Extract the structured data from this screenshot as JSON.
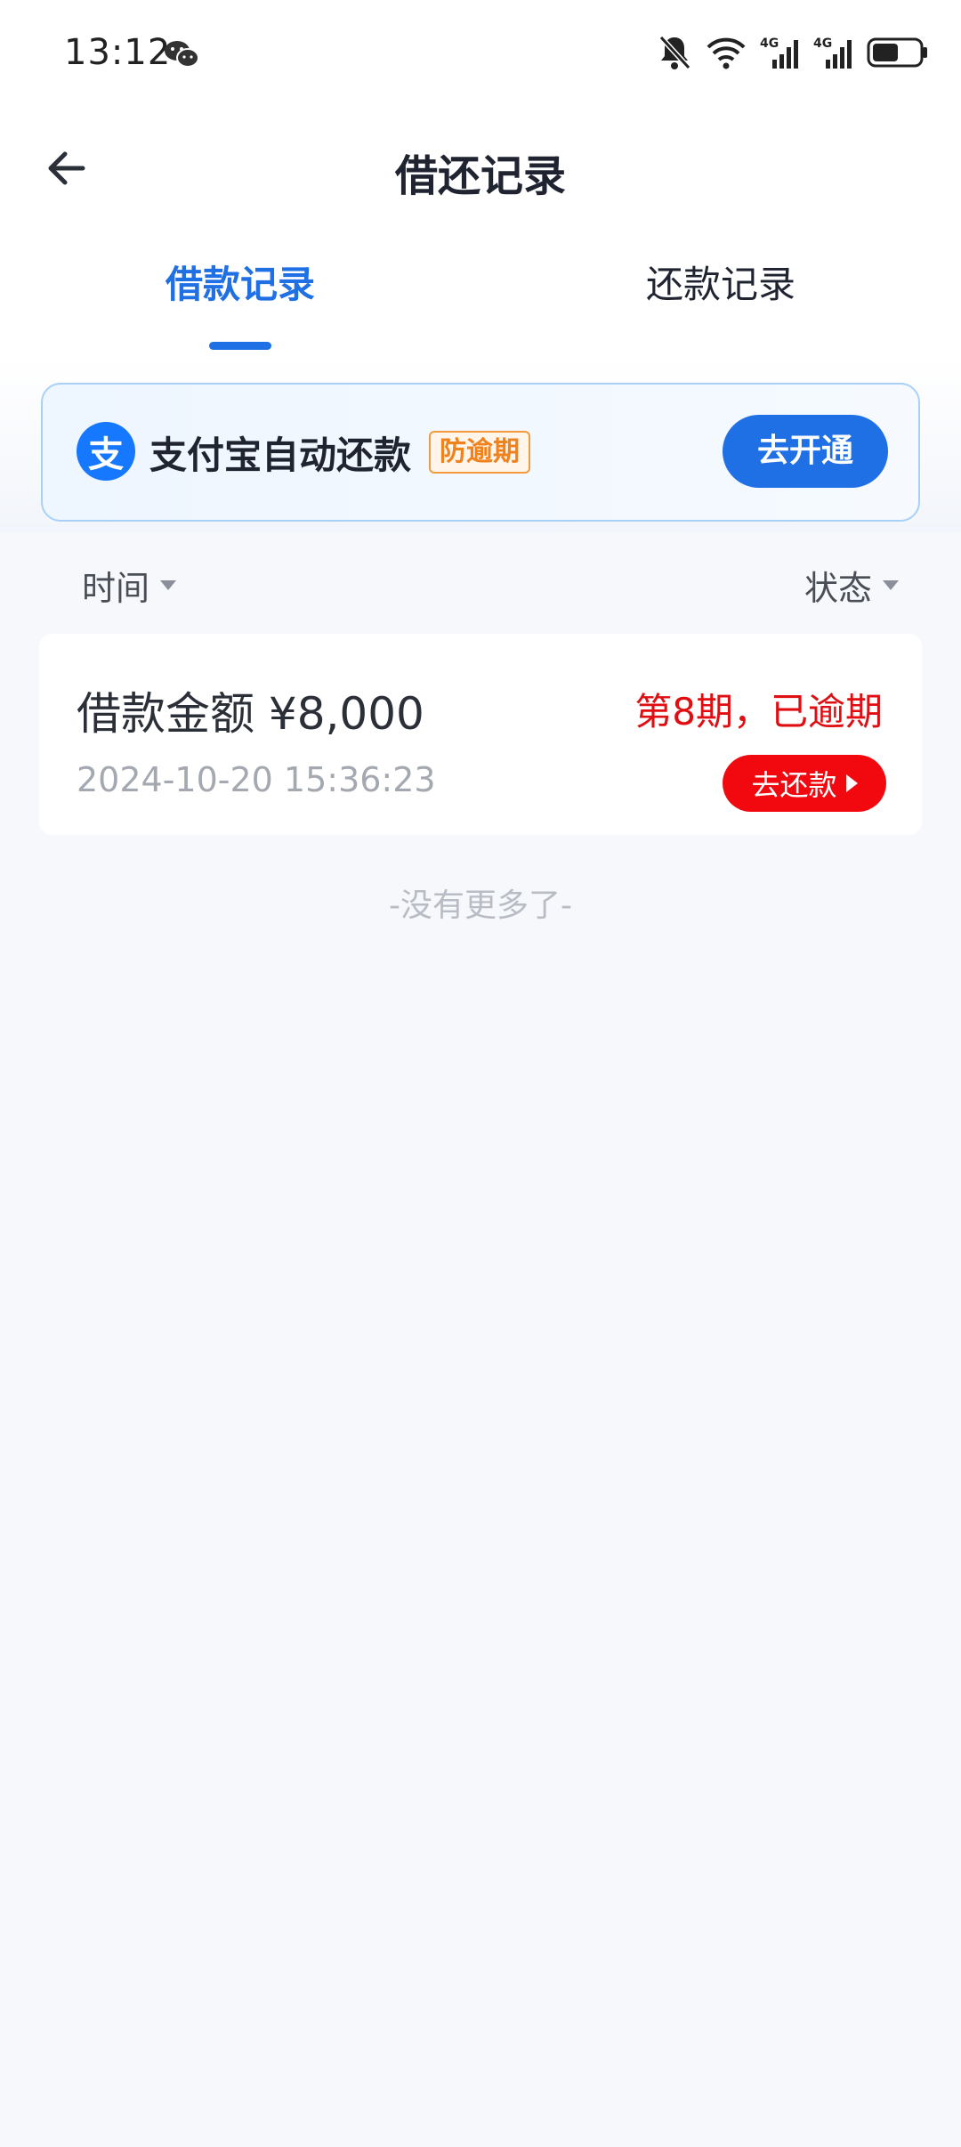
{
  "status_bar": {
    "time": "13:12",
    "icons": [
      "wechat-icon",
      "bell-muted-icon",
      "wifi-icon",
      "signal-4g-icon",
      "signal-4g-icon",
      "battery-icon"
    ],
    "network_label": "4G"
  },
  "header": {
    "title": "借还记录",
    "back_icon": "arrow-left-icon"
  },
  "tabs": [
    {
      "label": "借款记录",
      "active": true
    },
    {
      "label": "还款记录",
      "active": false
    }
  ],
  "banner": {
    "icon": "alipay-icon",
    "icon_glyph": "支",
    "text": "支付宝自动还款",
    "tag": "防逾期",
    "button_label": "去开通"
  },
  "filters": {
    "time_label": "时间",
    "status_label": "状态"
  },
  "records": [
    {
      "amount_label": "借款金额 ¥8,000",
      "date": "2024-10-20 15:36:23",
      "status": "第8期，已逾期",
      "button_label": "去还款"
    }
  ],
  "end_text": "-没有更多了-",
  "colors": {
    "accent": "#1f6fe5",
    "overdue_red": "#e00e12",
    "button_red": "#f2090f",
    "tag_orange": "#f0821e"
  }
}
